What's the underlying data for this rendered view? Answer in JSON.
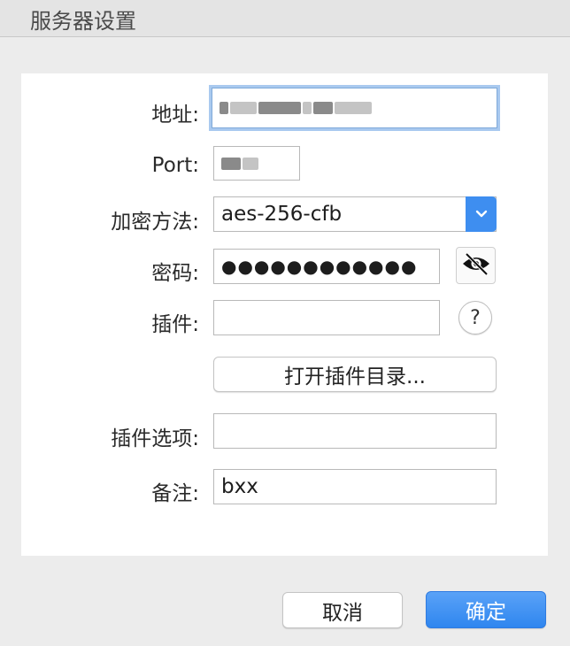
{
  "window": {
    "title": "服务器设置"
  },
  "form": {
    "address": {
      "label": "地址:"
    },
    "port": {
      "label": "Port:"
    },
    "encryption": {
      "label": "加密方法:",
      "value": "aes-256-cfb"
    },
    "password": {
      "label": "密码:",
      "value": "●●●●●●●●●●●●"
    },
    "plugin": {
      "label": "插件:",
      "value": "",
      "help": "?"
    },
    "open_plugin_dir": {
      "label": "打开插件目录..."
    },
    "plugin_options": {
      "label": "插件选项:",
      "value": ""
    },
    "remark": {
      "label": "备注:",
      "value": "bxx"
    }
  },
  "footer": {
    "cancel_label": "取消",
    "confirm_label": "确定"
  },
  "colors": {
    "accent": "#3e8ef0",
    "focus_ring": "#a9c9ef"
  },
  "icons": {
    "select": "chevron-down-icon",
    "reveal": "eye-slash-icon",
    "help": "question-icon"
  }
}
